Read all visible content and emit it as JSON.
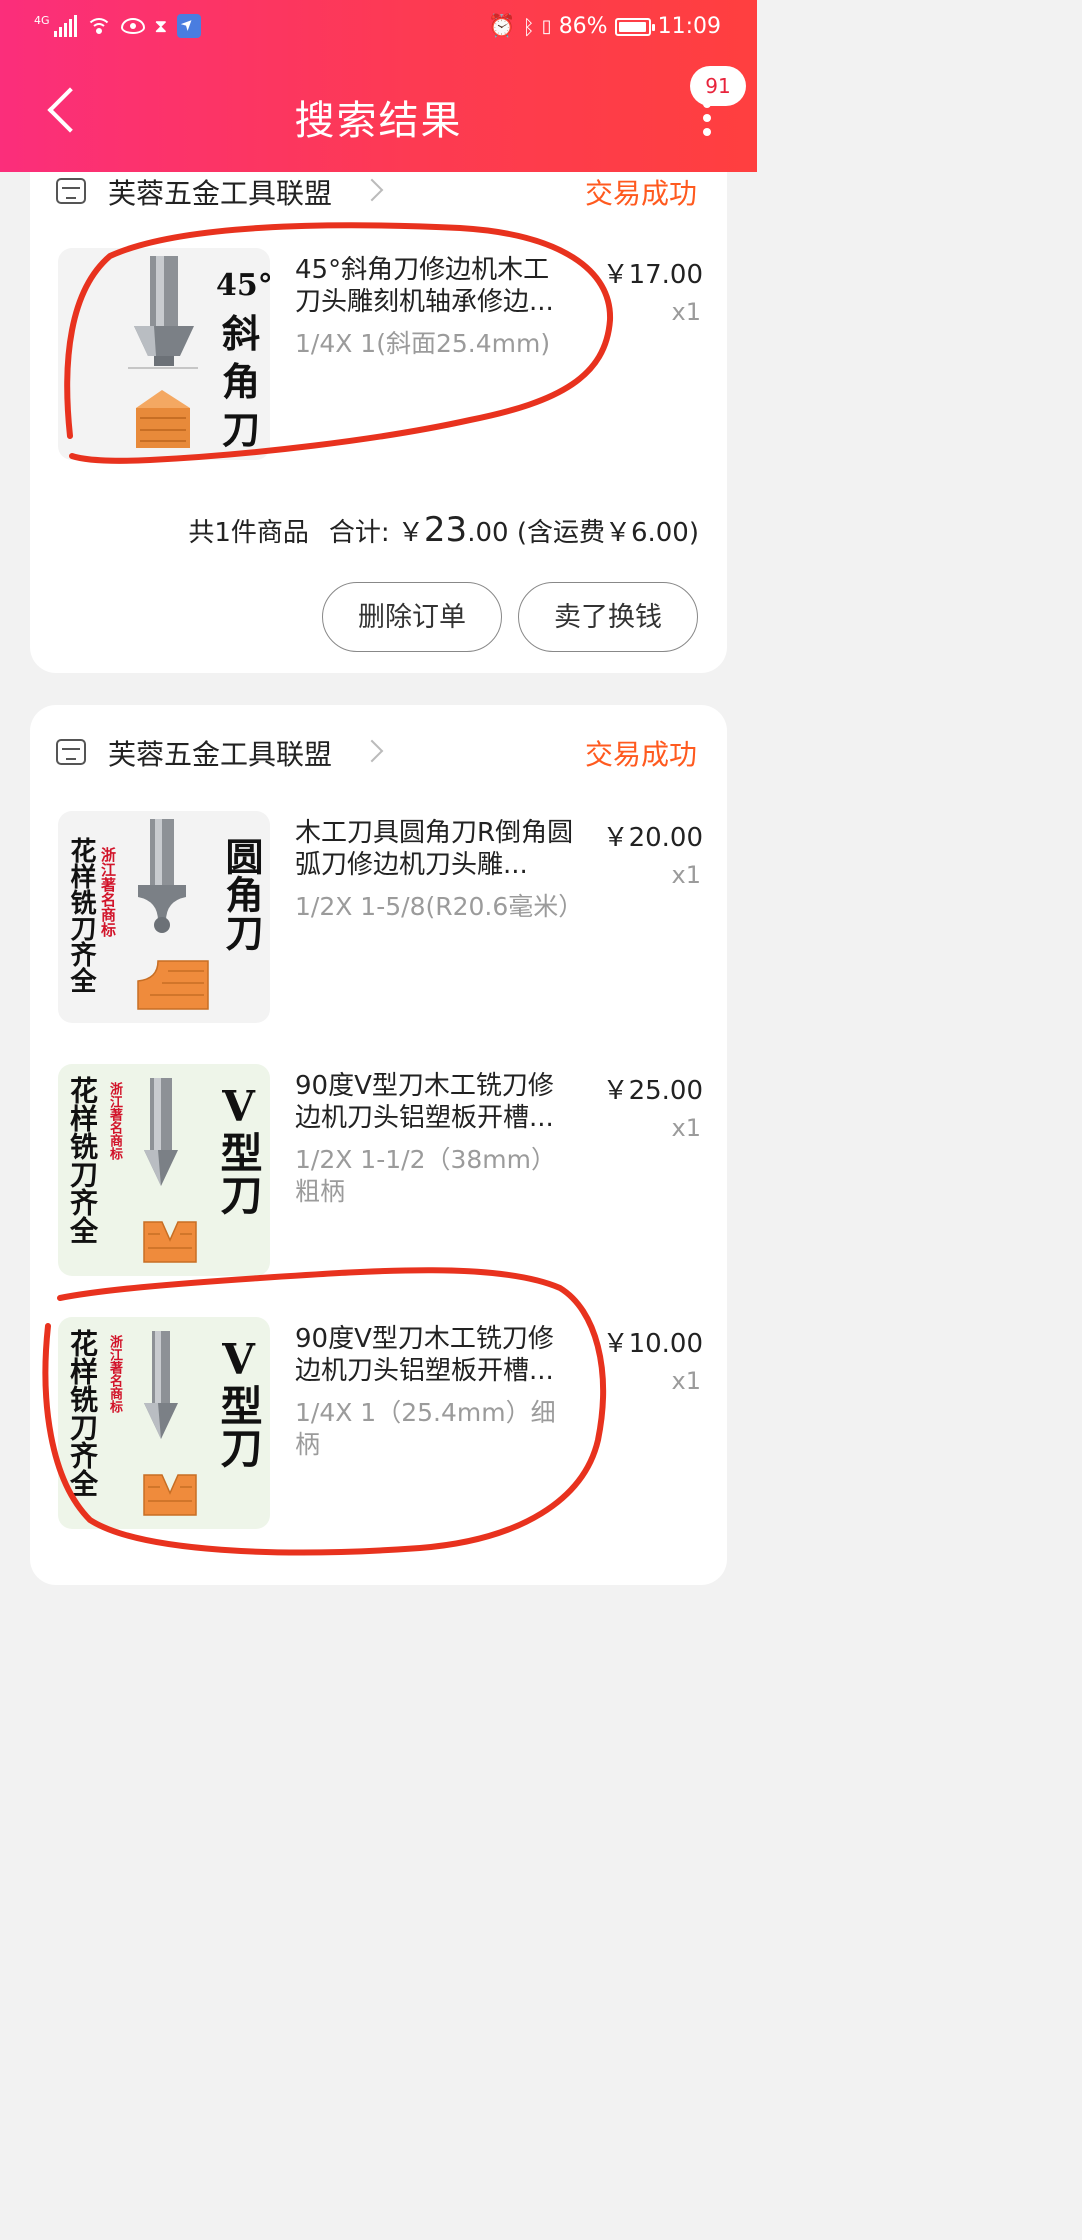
{
  "status_bar": {
    "network": "4G",
    "battery": "86%",
    "time": "11:09"
  },
  "header": {
    "title": "搜索结果",
    "badge": "91"
  },
  "orders": [
    {
      "store": "芙蓉五金工具联盟",
      "status": "交易成功",
      "items": [
        {
          "thumb_text": [
            "45°",
            "斜",
            "角",
            "刀"
          ],
          "title": "45°斜角刀修边机木工刀头雕刻机轴承修边...",
          "spec": "1/4X 1(斜面25.4mm)",
          "price": "￥17.00",
          "qty": "x1"
        }
      ],
      "summary": {
        "count": "共1件商品",
        "total_label": "合计:",
        "currency": "￥",
        "total_int": "23",
        "total_dec": ".00",
        "shipping": "(含运费￥6.00)"
      },
      "buttons": {
        "delete": "删除订单",
        "sell": "卖了换钱"
      }
    },
    {
      "store": "芙蓉五金工具联盟",
      "status": "交易成功",
      "items": [
        {
          "thumb_text": [
            "花样铣刀齐全",
            "浙江著名商标",
            "圆角刀"
          ],
          "title": "木工刀具圆角刀R倒角圆弧刀修边机刀头雕...",
          "spec": "1/2X 1-5/8(R20.6毫米）",
          "price": "￥20.00",
          "qty": "x1"
        },
        {
          "thumb_text": [
            "花样铣刀齐全",
            "浙江著名商标",
            "V型刀"
          ],
          "title": "90度V型刀木工铣刀修边机刀头铝塑板开槽...",
          "spec": "1/2X 1-1/2（38mm）粗柄",
          "price": "￥25.00",
          "qty": "x1"
        },
        {
          "thumb_text": [
            "花样铣刀齐全",
            "浙江著名商标",
            "V型刀"
          ],
          "title": "90度V型刀木工铣刀修边机刀头铝塑板开槽...",
          "spec": "1/4X 1（25.4mm）细柄",
          "price": "￥10.00",
          "qty": "x1"
        }
      ]
    }
  ]
}
